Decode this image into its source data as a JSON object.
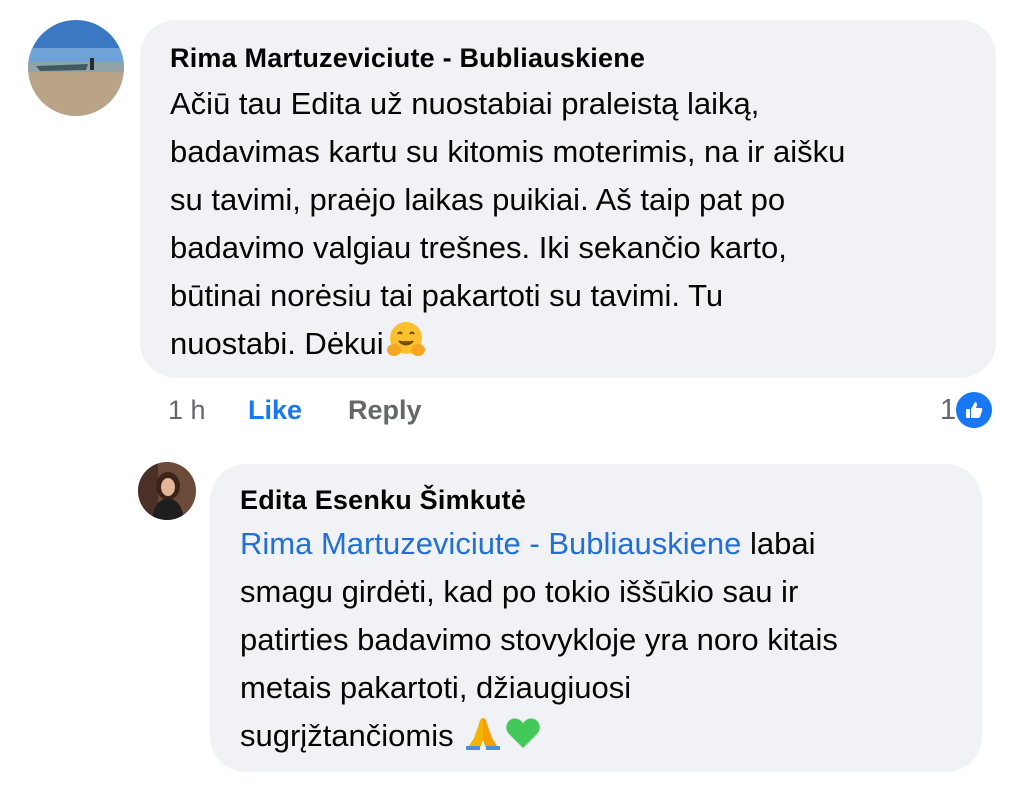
{
  "comment": {
    "author": "Rima Martuzeviciute - Bubliauskiene",
    "lines": [
      "Ačiū tau Edita už nuostabiai praleistą laiką,",
      "badavimas kartu su kitomis moterimis, na ir aišku",
      "su tavimi, praėjo laikas puikiai. Aš taip pat po",
      "badavimo valgiau trešnes. Iki sekančio karto,",
      "būtinai norėsiu tai pakartoti su tavimi. Tu",
      "nuostabi. Dėkui"
    ],
    "emoji": "hugging-face-icon",
    "time": "1 h",
    "like_label": "Like",
    "reply_label": "Reply",
    "reaction_count": "1",
    "reaction_icon": "like-icon"
  },
  "reply": {
    "author": "Edita Esenku Šimkutė",
    "mention": "Rima Martuzeviciute - Bubliauskiene",
    "lines": [
      " labai",
      "smagu girdėti, kad po tokio iššūkio sau ir",
      "patirties badavimo stovykloje yra noro kitais",
      "metais pakartoti, džiaugiuosi",
      "sugrįžtančiomis "
    ],
    "emojis": [
      "folded-hands-icon",
      "green-heart-icon"
    ]
  },
  "colors": {
    "bubble": "#f0f2f5",
    "mention": "#216fdb",
    "like": "#1877f2",
    "secondary_text": "#65676b"
  }
}
